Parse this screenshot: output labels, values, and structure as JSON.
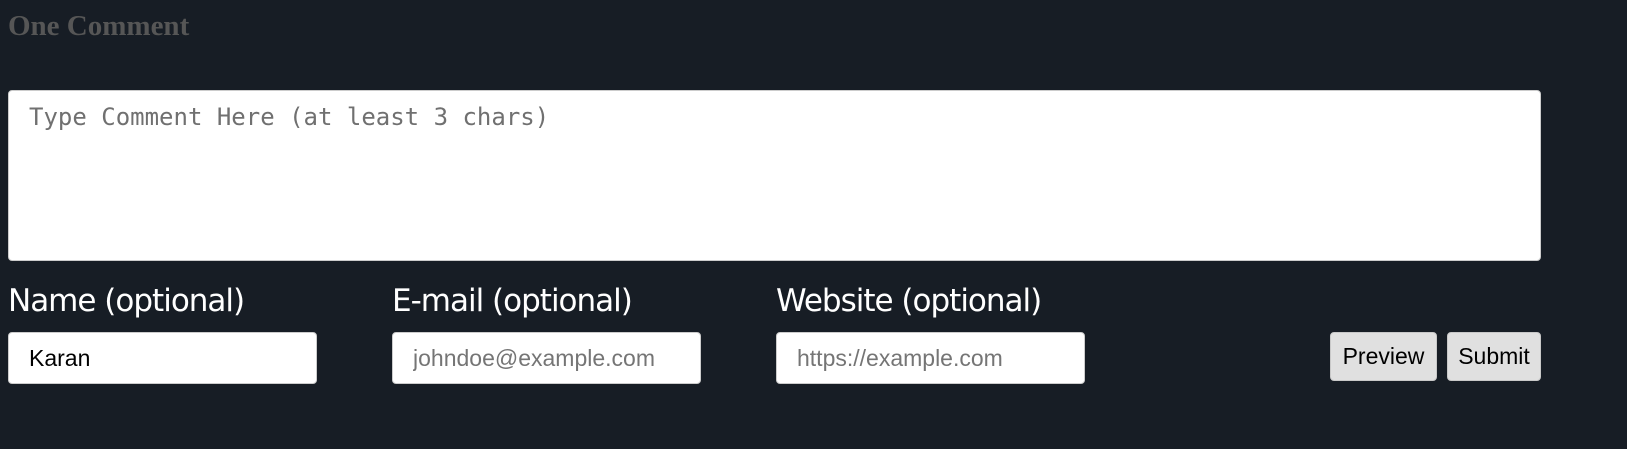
{
  "comments": {
    "heading": "One Comment"
  },
  "form": {
    "comment": {
      "value": "",
      "placeholder": "Type Comment Here (at least 3 chars)"
    },
    "name": {
      "label": "Name (optional)",
      "value": "Karan",
      "placeholder": ""
    },
    "email": {
      "label": "E-mail (optional)",
      "value": "",
      "placeholder": "johndoe@example.com"
    },
    "website": {
      "label": "Website (optional)",
      "value": "",
      "placeholder": "https://example.com"
    },
    "preview_label": "Preview",
    "submit_label": "Submit"
  }
}
